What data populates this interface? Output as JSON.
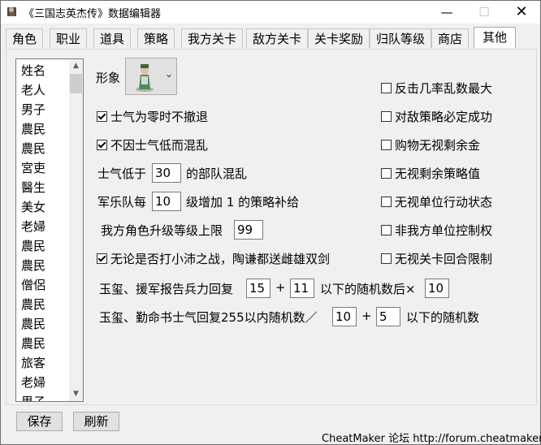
{
  "window": {
    "title": "《三国志英杰传》数据编辑器",
    "min": "—",
    "max": "☐",
    "close": "✕"
  },
  "tabs": [
    "角色",
    "职业",
    "道具",
    "策略",
    "我方关卡",
    "敌方关卡",
    "关卡奖励",
    "归队等级",
    "商店",
    "其他"
  ],
  "active_tab": "其他",
  "list": {
    "items": [
      "姓名",
      "老人",
      "男子",
      "農民",
      "農民",
      "宮吏",
      "醫生",
      "美女",
      "老婦",
      "農民",
      "農民",
      "僧侶",
      "農民",
      "農民",
      "農民",
      "旅客",
      "老婦",
      "男子"
    ],
    "scroll_up": "▲",
    "scroll_down": "▼"
  },
  "image_label": "形象",
  "image_combo_arrow": "⌄",
  "left_options": {
    "morale_zero": {
      "label": "士气为零时不撤退",
      "checked": true
    },
    "no_confusion": {
      "label": "不因士气低而混乱",
      "checked": true
    },
    "morale_below_prefix": "士气低于",
    "morale_below_value": "30",
    "morale_below_suffix": "的部队混乱",
    "band_prefix": "军乐队每",
    "band_value": "10",
    "band_suffix": "级增加 1 的策略补给",
    "level_cap_label": "我方角色升级等级上限",
    "level_cap_value": "99",
    "xiaopei": {
      "label": "无论是否打小沛之战，陶谦都送雌雄双剑",
      "checked": true
    }
  },
  "right_options": [
    {
      "label": "反击几率乱数最大",
      "checked": false
    },
    {
      "label": "对敌策略必定成功",
      "checked": false
    },
    {
      "label": "购物无视剩余金",
      "checked": false
    },
    {
      "label": "无视剩余策略值",
      "checked": false
    },
    {
      "label": "无视单位行动状态",
      "checked": false
    },
    {
      "label": "非我方单位控制权",
      "checked": false
    },
    {
      "label": "无视关卡回合限制",
      "checked": false
    }
  ],
  "formula1": {
    "prefix": "玉玺、援军报告兵力回复",
    "a": "15",
    "plus": "+",
    "b": "11",
    "mid": "以下的随机数后×",
    "c": "10"
  },
  "formula2": {
    "prefix": "玉玺、勤命书士气回复255以内随机数／",
    "a": "10",
    "plus": "+",
    "b": "5",
    "suffix": "以下的随机数"
  },
  "buttons": {
    "save": "保存",
    "refresh": "刷新"
  },
  "footer": "CheatMaker 论坛 http://forum.cheatmaker.org/"
}
